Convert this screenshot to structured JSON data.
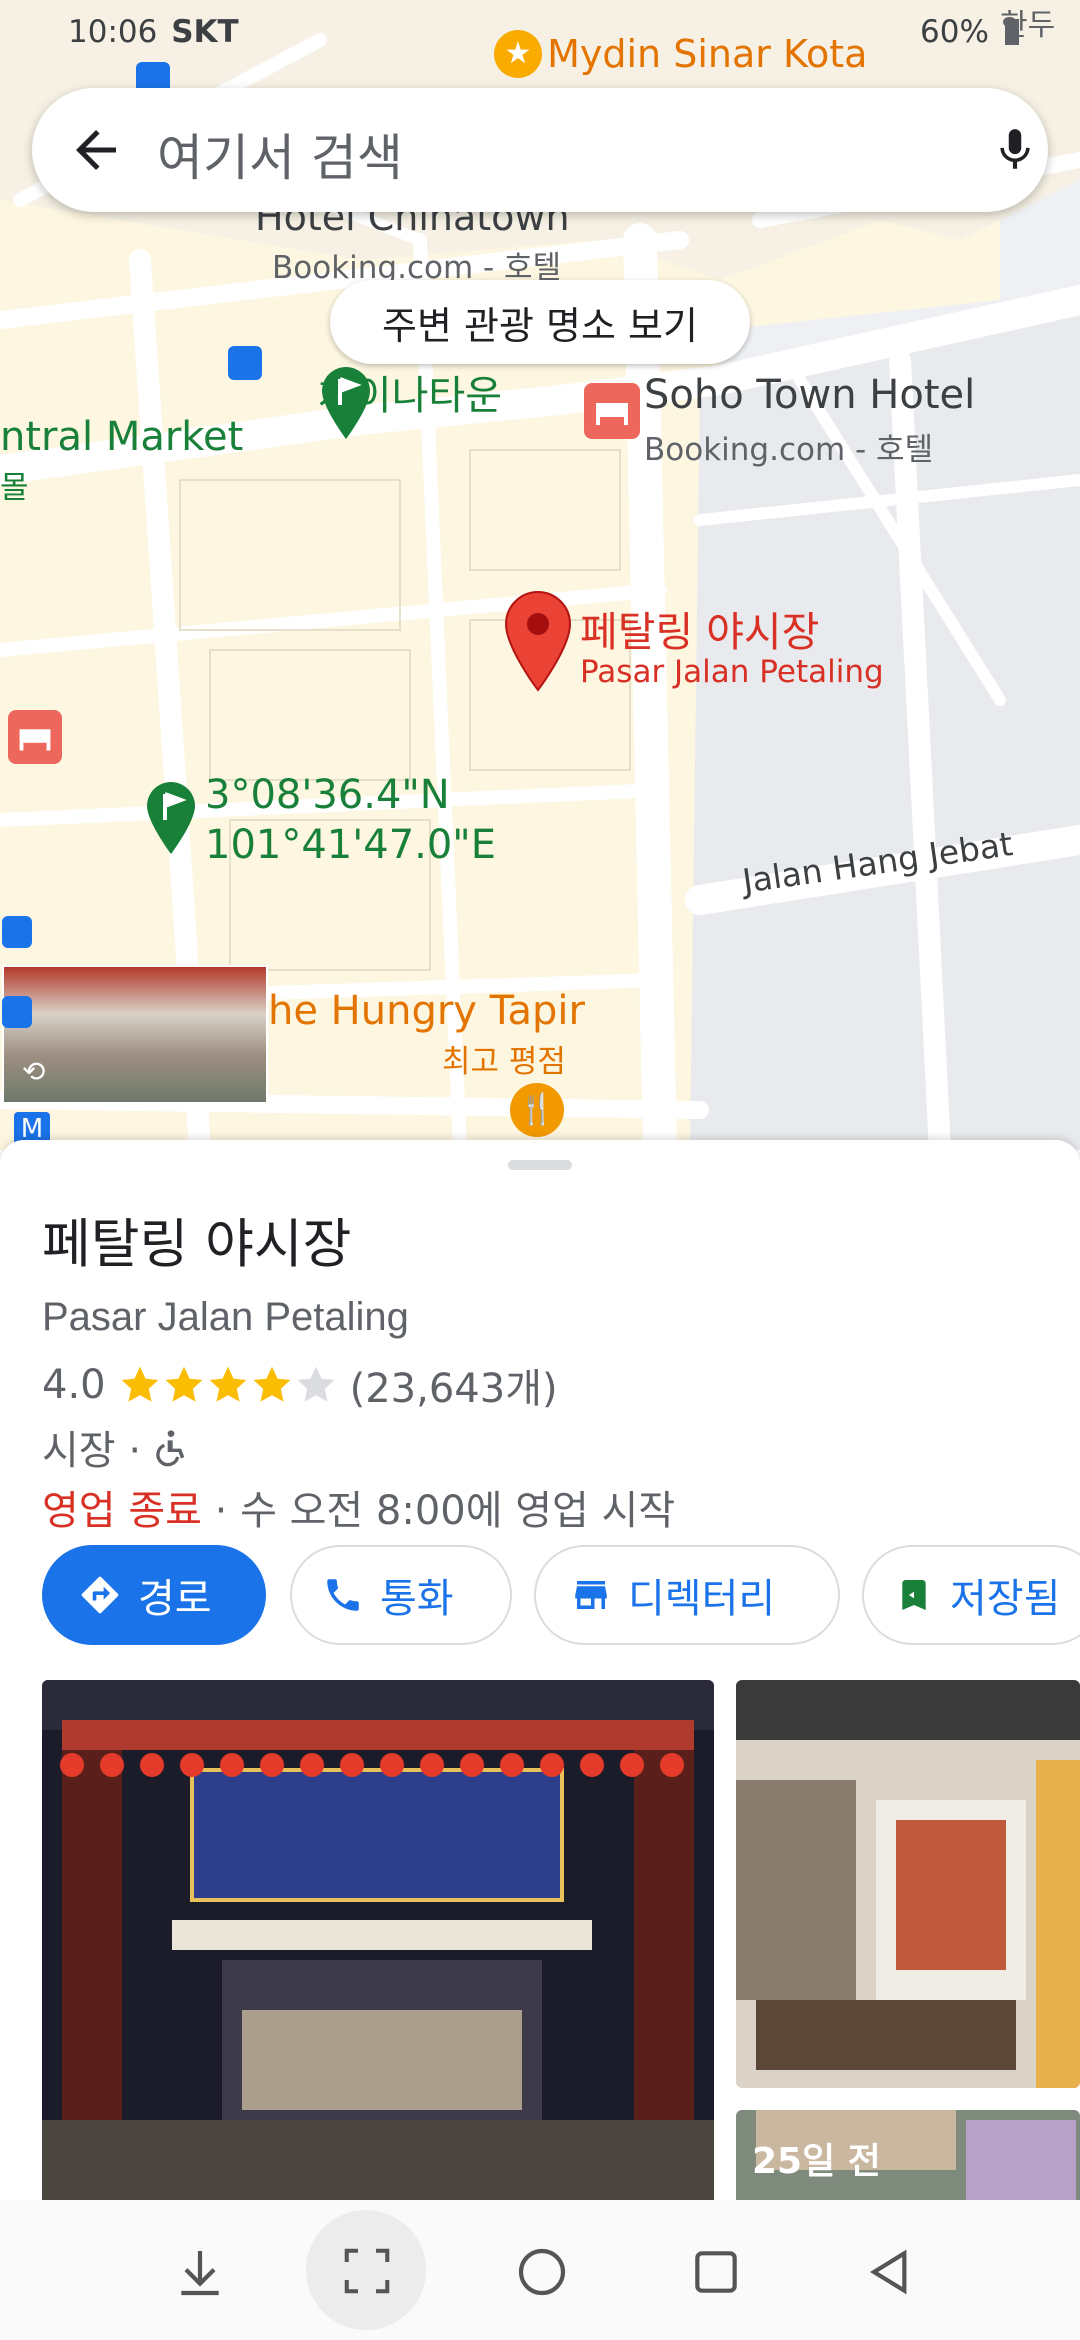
{
  "status_bar": {
    "time": "10:06",
    "carrier": "SKT",
    "battery": "60%"
  },
  "search": {
    "placeholder": "여기서 검색"
  },
  "map": {
    "chip_label": "주변 관광 명소 보기",
    "labels": {
      "mydin": "Mydin Sinar Kota",
      "hotel_chinatown": "Hotel Chinatown",
      "hotel_chinatown_sub": "Booking.com - 호텔",
      "chinatown": "차이나타운",
      "soho_hotel": "Soho Town Hotel",
      "soho_hotel_sub": "Booking.com - 호텔",
      "central_market": "ntral Market",
      "central_market_sub": "몰",
      "pin_name": "페탈링 야시장",
      "pin_name_sub": "Pasar Jalan Petaling",
      "coord_lat": "3°08'36.4\"N",
      "coord_lng": "101°41'47.0\"E",
      "street": "Jalan Hang Jebat",
      "hungry_tapir": "he Hungry Tapir",
      "hungry_tapir_sub": "최고 평점",
      "corner_top": "한두"
    }
  },
  "place": {
    "title": "페탈링 야시장",
    "subtitle": "Pasar Jalan Petaling",
    "rating": "4.0",
    "stars": 4,
    "review_count": "(23,643개)",
    "category": "시장 ·",
    "status_closed": "영업 종료",
    "status_hours": " · 수 오전 8:00에 영업 시작",
    "photo_badge": "25일 전"
  },
  "actions": {
    "directions": "경로",
    "call": "통화",
    "directory": "디렉터리",
    "saved": "저장됨"
  },
  "colors": {
    "accent": "#1a73e8",
    "closed": "#d93025",
    "star": "#fbbc04",
    "pin": "#ea4335",
    "green_label": "#188038",
    "orange_label": "#e37400"
  }
}
